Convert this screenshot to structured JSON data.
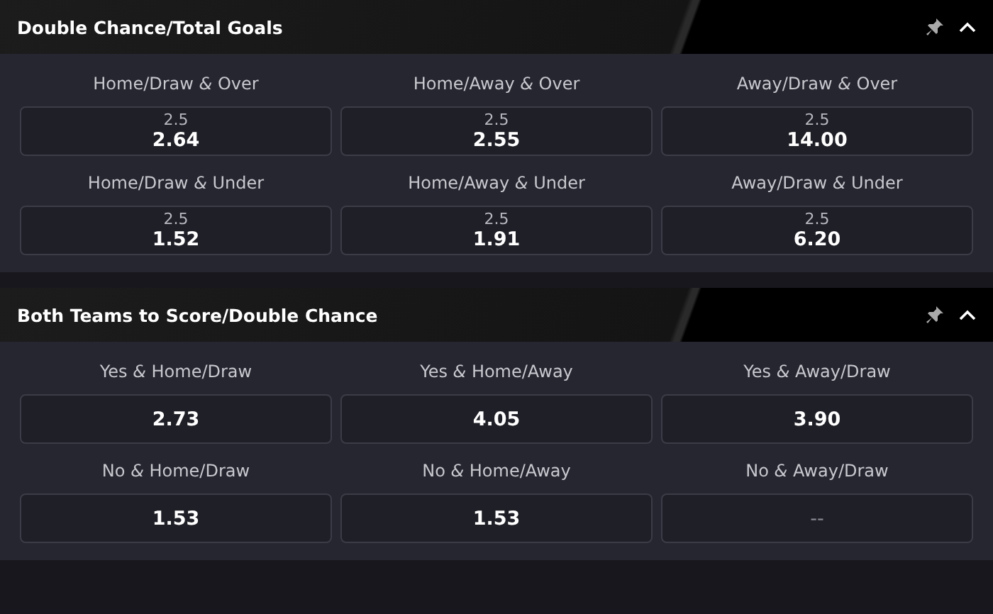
{
  "sections": [
    {
      "title": "Double Chance/Total Goals",
      "expanded": true,
      "markets": [
        {
          "label": "Home/Draw **&** Over",
          "line": "2.5",
          "odds": "2.64",
          "disabled": false
        },
        {
          "label": "Home/Away **&** Over",
          "line": "2.5",
          "odds": "2.55",
          "disabled": false
        },
        {
          "label": "Away/Draw **&** Over",
          "line": "2.5",
          "odds": "14.00",
          "disabled": false
        },
        {
          "label": "Home/Draw **&** Under",
          "line": "2.5",
          "odds": "1.52",
          "disabled": false
        },
        {
          "label": "Home/Away **&** Under",
          "line": "2.5",
          "odds": "1.91",
          "disabled": false
        },
        {
          "label": "Away/Draw **&** Under",
          "line": "2.5",
          "odds": "6.20",
          "disabled": false
        }
      ]
    },
    {
      "title": "Both Teams to Score/Double Chance",
      "expanded": true,
      "markets": [
        {
          "label": "Yes **&** Home/Draw",
          "odds": "2.73",
          "disabled": false
        },
        {
          "label": "Yes **&** Home/Away",
          "odds": "4.05",
          "disabled": false
        },
        {
          "label": "Yes **&** Away/Draw",
          "odds": "3.90",
          "disabled": false
        },
        {
          "label": "No **&** Home/Draw",
          "odds": "1.53",
          "disabled": false
        },
        {
          "label": "No **&** Home/Away",
          "odds": "1.53",
          "disabled": false
        },
        {
          "label": "No **&** Away/Draw",
          "odds": "--",
          "disabled": true
        }
      ]
    }
  ]
}
